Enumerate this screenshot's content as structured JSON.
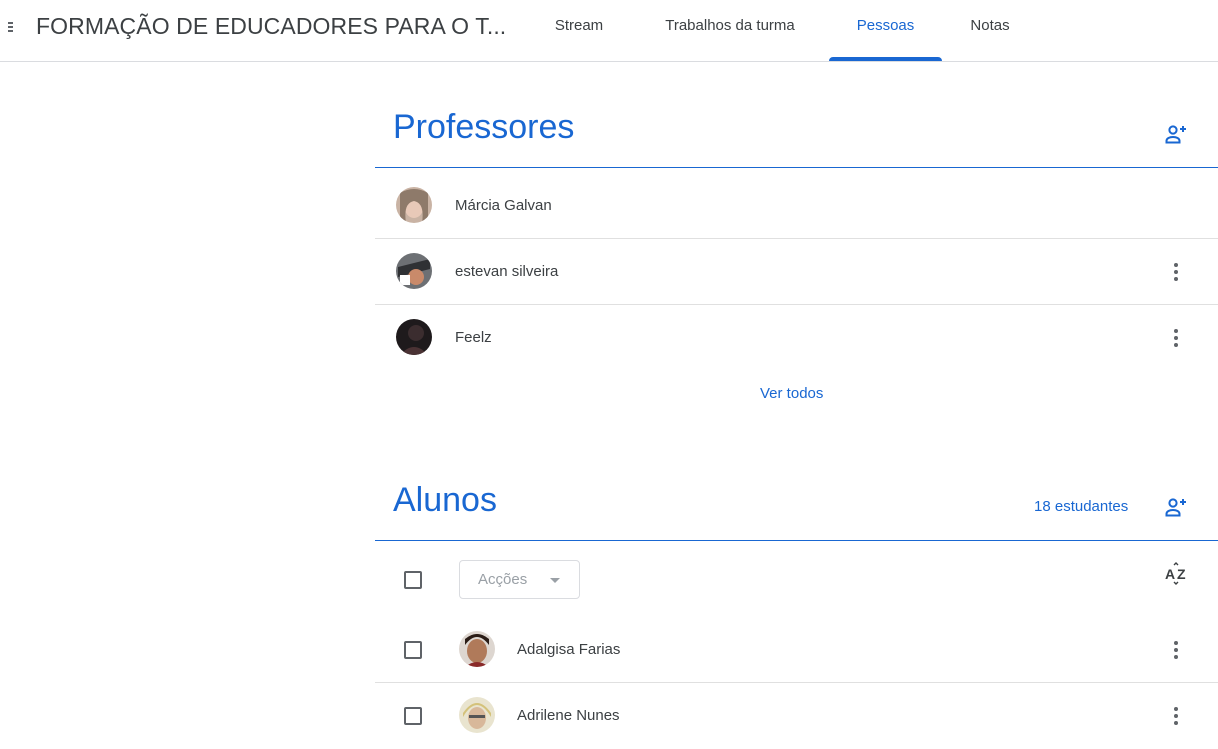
{
  "header": {
    "class_title": "FORMAÇÃO DE EDUCADORES PARA O T...",
    "tabs": [
      {
        "label": "Stream",
        "active": false
      },
      {
        "label": "Trabalhos da turma",
        "active": false
      },
      {
        "label": "Pessoas",
        "active": true
      },
      {
        "label": "Notas",
        "active": false
      }
    ]
  },
  "teachers": {
    "title": "Professores",
    "add_icon": "add-person-icon",
    "people": [
      {
        "name": "Márcia Galvan",
        "avatar": "photo",
        "has_menu": false
      },
      {
        "name": "estevan silveira",
        "avatar": "photo",
        "has_menu": true
      },
      {
        "name": "Feelz",
        "avatar": "photo",
        "has_menu": true
      }
    ],
    "see_all": "Ver todos"
  },
  "students": {
    "title": "Alunos",
    "count": "18 estudantes",
    "add_icon": "add-person-icon",
    "actions_placeholder": "Acções",
    "sort_icon": "sort-az-icon",
    "people": [
      {
        "name": "Adalgisa Farias",
        "avatar": "photo"
      },
      {
        "name": "Adrilene Nunes",
        "avatar": "photo"
      }
    ]
  },
  "colors": {
    "accent": "#1967d2",
    "text": "#3c4043",
    "icon": "#5f6368",
    "divider": "#e0e0e0"
  }
}
